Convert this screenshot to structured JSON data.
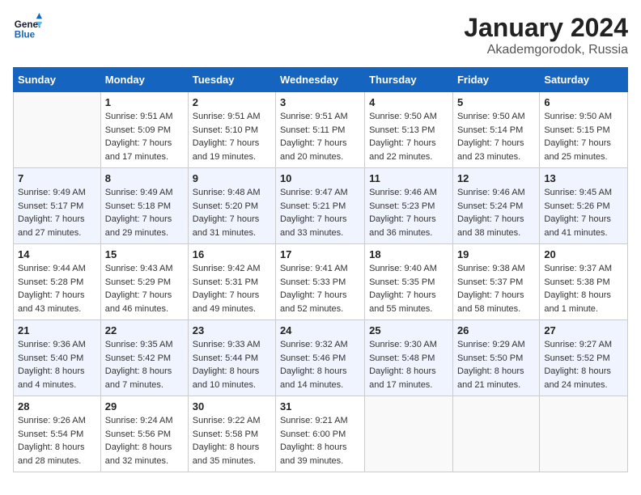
{
  "header": {
    "logo_general": "General",
    "logo_blue": "Blue",
    "title": "January 2024",
    "subtitle": "Akademgorodok, Russia"
  },
  "days_of_week": [
    "Sunday",
    "Monday",
    "Tuesday",
    "Wednesday",
    "Thursday",
    "Friday",
    "Saturday"
  ],
  "weeks": [
    [
      {
        "day": "",
        "info": ""
      },
      {
        "day": "1",
        "info": "Sunrise: 9:51 AM\nSunset: 5:09 PM\nDaylight: 7 hours\nand 17 minutes."
      },
      {
        "day": "2",
        "info": "Sunrise: 9:51 AM\nSunset: 5:10 PM\nDaylight: 7 hours\nand 19 minutes."
      },
      {
        "day": "3",
        "info": "Sunrise: 9:51 AM\nSunset: 5:11 PM\nDaylight: 7 hours\nand 20 minutes."
      },
      {
        "day": "4",
        "info": "Sunrise: 9:50 AM\nSunset: 5:13 PM\nDaylight: 7 hours\nand 22 minutes."
      },
      {
        "day": "5",
        "info": "Sunrise: 9:50 AM\nSunset: 5:14 PM\nDaylight: 7 hours\nand 23 minutes."
      },
      {
        "day": "6",
        "info": "Sunrise: 9:50 AM\nSunset: 5:15 PM\nDaylight: 7 hours\nand 25 minutes."
      }
    ],
    [
      {
        "day": "7",
        "info": "Sunrise: 9:49 AM\nSunset: 5:17 PM\nDaylight: 7 hours\nand 27 minutes."
      },
      {
        "day": "8",
        "info": "Sunrise: 9:49 AM\nSunset: 5:18 PM\nDaylight: 7 hours\nand 29 minutes."
      },
      {
        "day": "9",
        "info": "Sunrise: 9:48 AM\nSunset: 5:20 PM\nDaylight: 7 hours\nand 31 minutes."
      },
      {
        "day": "10",
        "info": "Sunrise: 9:47 AM\nSunset: 5:21 PM\nDaylight: 7 hours\nand 33 minutes."
      },
      {
        "day": "11",
        "info": "Sunrise: 9:46 AM\nSunset: 5:23 PM\nDaylight: 7 hours\nand 36 minutes."
      },
      {
        "day": "12",
        "info": "Sunrise: 9:46 AM\nSunset: 5:24 PM\nDaylight: 7 hours\nand 38 minutes."
      },
      {
        "day": "13",
        "info": "Sunrise: 9:45 AM\nSunset: 5:26 PM\nDaylight: 7 hours\nand 41 minutes."
      }
    ],
    [
      {
        "day": "14",
        "info": "Sunrise: 9:44 AM\nSunset: 5:28 PM\nDaylight: 7 hours\nand 43 minutes."
      },
      {
        "day": "15",
        "info": "Sunrise: 9:43 AM\nSunset: 5:29 PM\nDaylight: 7 hours\nand 46 minutes."
      },
      {
        "day": "16",
        "info": "Sunrise: 9:42 AM\nSunset: 5:31 PM\nDaylight: 7 hours\nand 49 minutes."
      },
      {
        "day": "17",
        "info": "Sunrise: 9:41 AM\nSunset: 5:33 PM\nDaylight: 7 hours\nand 52 minutes."
      },
      {
        "day": "18",
        "info": "Sunrise: 9:40 AM\nSunset: 5:35 PM\nDaylight: 7 hours\nand 55 minutes."
      },
      {
        "day": "19",
        "info": "Sunrise: 9:38 AM\nSunset: 5:37 PM\nDaylight: 7 hours\nand 58 minutes."
      },
      {
        "day": "20",
        "info": "Sunrise: 9:37 AM\nSunset: 5:38 PM\nDaylight: 8 hours\nand 1 minute."
      }
    ],
    [
      {
        "day": "21",
        "info": "Sunrise: 9:36 AM\nSunset: 5:40 PM\nDaylight: 8 hours\nand 4 minutes."
      },
      {
        "day": "22",
        "info": "Sunrise: 9:35 AM\nSunset: 5:42 PM\nDaylight: 8 hours\nand 7 minutes."
      },
      {
        "day": "23",
        "info": "Sunrise: 9:33 AM\nSunset: 5:44 PM\nDaylight: 8 hours\nand 10 minutes."
      },
      {
        "day": "24",
        "info": "Sunrise: 9:32 AM\nSunset: 5:46 PM\nDaylight: 8 hours\nand 14 minutes."
      },
      {
        "day": "25",
        "info": "Sunrise: 9:30 AM\nSunset: 5:48 PM\nDaylight: 8 hours\nand 17 minutes."
      },
      {
        "day": "26",
        "info": "Sunrise: 9:29 AM\nSunset: 5:50 PM\nDaylight: 8 hours\nand 21 minutes."
      },
      {
        "day": "27",
        "info": "Sunrise: 9:27 AM\nSunset: 5:52 PM\nDaylight: 8 hours\nand 24 minutes."
      }
    ],
    [
      {
        "day": "28",
        "info": "Sunrise: 9:26 AM\nSunset: 5:54 PM\nDaylight: 8 hours\nand 28 minutes."
      },
      {
        "day": "29",
        "info": "Sunrise: 9:24 AM\nSunset: 5:56 PM\nDaylight: 8 hours\nand 32 minutes."
      },
      {
        "day": "30",
        "info": "Sunrise: 9:22 AM\nSunset: 5:58 PM\nDaylight: 8 hours\nand 35 minutes."
      },
      {
        "day": "31",
        "info": "Sunrise: 9:21 AM\nSunset: 6:00 PM\nDaylight: 8 hours\nand 39 minutes."
      },
      {
        "day": "",
        "info": ""
      },
      {
        "day": "",
        "info": ""
      },
      {
        "day": "",
        "info": ""
      }
    ]
  ]
}
